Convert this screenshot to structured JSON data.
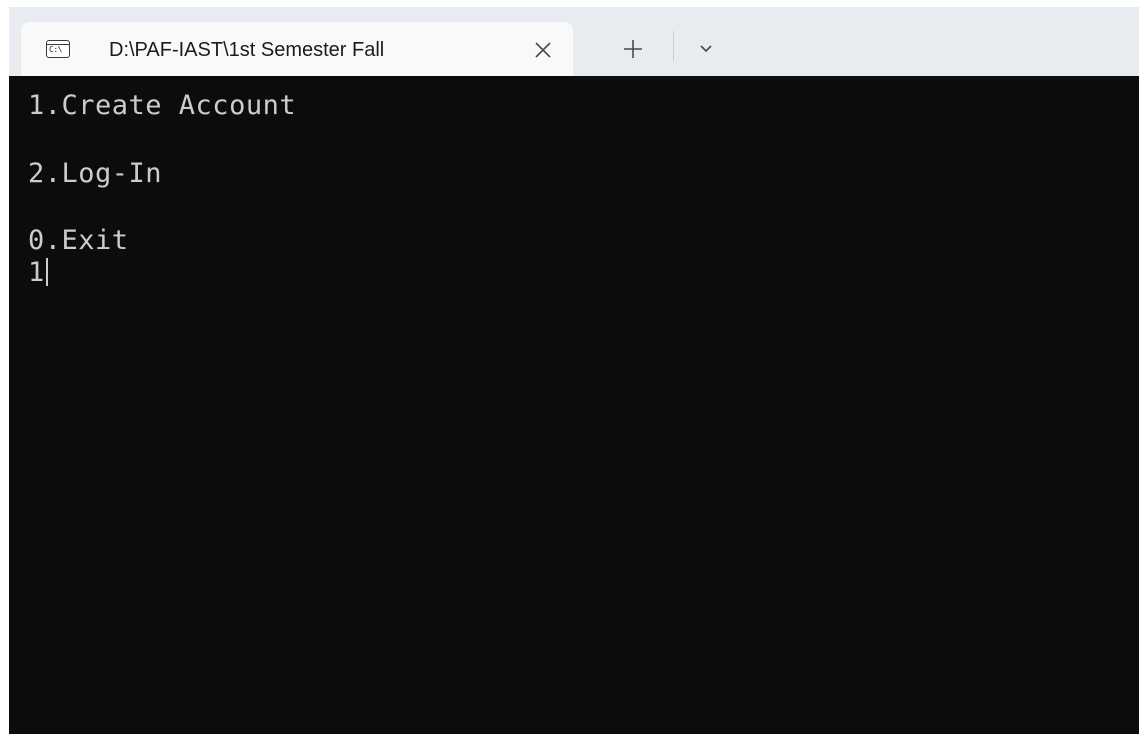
{
  "window": {
    "tab": {
      "icon": "console-icon",
      "icon_text": "C:\\",
      "title": "D:\\PAF-IAST\\1st Semester Fall"
    },
    "controls": {
      "close_icon": "close-icon",
      "new_tab_icon": "plus-icon",
      "dropdown_icon": "chevron-down-icon"
    }
  },
  "console": {
    "lines": [
      "1.Create Account",
      "2.Log-In",
      "0.Exit"
    ],
    "input": "1"
  },
  "colors": {
    "background": "#0c0c0c",
    "text": "#cccccc",
    "titlebar": "#e8ebef",
    "tab_active": "#f9f9f9"
  }
}
